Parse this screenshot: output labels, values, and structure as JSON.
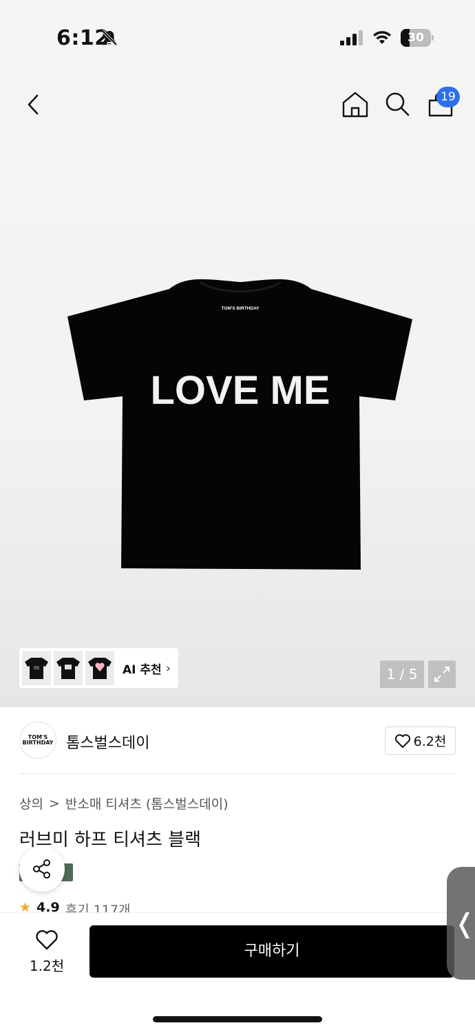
{
  "status_bar": {
    "time": "6:12",
    "battery": "30",
    "battery_level": 0.3
  },
  "nav": {
    "cart_count": "19"
  },
  "product_image": {
    "shirt_text": "LOVE ME",
    "shirt_tag": "TOM'S BIRTHDAY"
  },
  "ai_recommend": {
    "label": "AI 추천",
    "chevron": "›"
  },
  "gallery": {
    "pager": "1 / 5"
  },
  "brand": {
    "name": "톰스벌스데이",
    "logo_text": "TOM'S BIRTHDAY",
    "likes": "6.2천"
  },
  "breadcrumb": {
    "category": "상의",
    "separator": ">",
    "subcategory": "반소매 티셔츠 (톰스벌스데이)"
  },
  "product": {
    "title": "러브미 하프 티셔츠 블랙",
    "rating": "4.9",
    "reviews": "후기 117개"
  },
  "bottom_bar": {
    "wish_count": "1.2천",
    "buy_label": "구매하기"
  },
  "side_handle": {
    "glyph": "❬"
  },
  "colors": {
    "accent_blue": "#2f6fea",
    "buy_button": "#000000",
    "star": "#f5a623"
  },
  "icons": [
    "back-icon",
    "home-icon",
    "search-icon",
    "cart-icon",
    "bell-off-icon",
    "heart-icon",
    "share-icon",
    "expand-icon",
    "star-icon"
  ]
}
